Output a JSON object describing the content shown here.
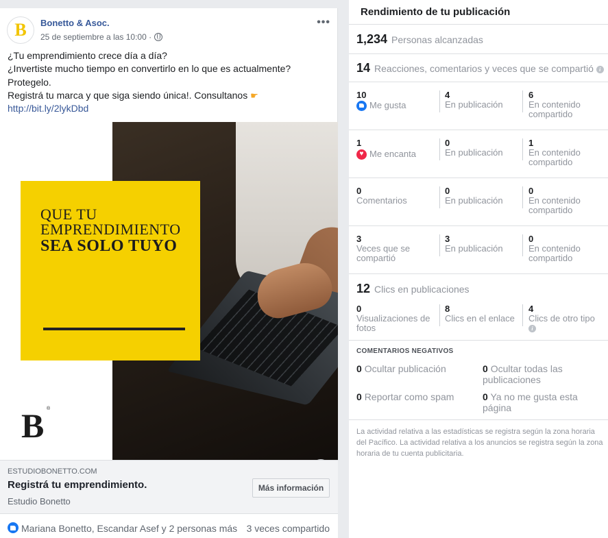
{
  "post": {
    "avatar_letter": "B",
    "author": "Bonetto & Asoc.",
    "date": "25 de septiembre a las 10:00 ·",
    "more": "•••",
    "text_lines": [
      "¿Tu emprendimiento crece día a día?",
      "¿Invertiste mucho tiempo en convertirlo en lo que es actualmente?",
      "Protegelo.",
      "Registrá tu marca y que siga siendo única!. Consultanos"
    ],
    "link": "http://bit.ly/2lykDbd",
    "ad_text": {
      "line1": "QUE TU",
      "line2": "EMPRENDIMIENTO",
      "line3": "SEA SOLO TUYO",
      "logo": "B",
      "reg": "®"
    },
    "info_glyph": "i",
    "preview": {
      "domain": "ESTUDIOBONETTO.COM",
      "title": "Registrá tu emprendimiento.",
      "description": "Estudio Bonetto",
      "cta": "Más información"
    },
    "footer": {
      "likes": "Mariana Bonetto, Escandar Asef y 2 personas más",
      "shares": "3 veces compartido"
    }
  },
  "panel": {
    "title": "Rendimiento de tu publicación",
    "reach": {
      "value": "1,234",
      "label": "Personas alcanzadas"
    },
    "engagement": {
      "value": "14",
      "label": "Reacciones, comentarios y veces que se compartió"
    },
    "rows": [
      {
        "c1_num": "10",
        "c1_label": "Me gusta",
        "c2_num": "4",
        "c2_label": "En publicación",
        "c3_num": "6",
        "c3_label": "En contenido compartido"
      },
      {
        "c1_num": "1",
        "c1_label": "Me encanta",
        "c2_num": "0",
        "c2_label": "En publicación",
        "c3_num": "1",
        "c3_label": "En contenido compartido"
      },
      {
        "c1_num": "0",
        "c1_label": "Comentarios",
        "c2_num": "0",
        "c2_label": "En publicación",
        "c3_num": "0",
        "c3_label": "En contenido compartido"
      },
      {
        "c1_num": "3",
        "c1_label": "Veces que se compartió",
        "c2_num": "3",
        "c2_label": "En publicación",
        "c3_num": "0",
        "c3_label": "En contenido compartido"
      }
    ],
    "clicks": {
      "value": "12",
      "label": "Clics en publicaciones"
    },
    "click_row": {
      "c1_num": "0",
      "c1_label": "Visualizaciones de fotos",
      "c2_num": "8",
      "c2_label": "Clics en el enlace",
      "c3_num": "4",
      "c3_label": "Clics de otro tipo"
    },
    "negative": {
      "title": "COMENTARIOS NEGATIVOS",
      "hide_post": {
        "value": "0",
        "label": "Ocultar publicación"
      },
      "hide_all": {
        "value": "0",
        "label": "Ocultar todas las publicaciones"
      },
      "spam": {
        "value": "0",
        "label": "Reportar como spam"
      },
      "unlike": {
        "value": "0",
        "label": "Ya no me gusta esta página"
      }
    },
    "footnote": "La actividad relativa a las estadísticas se registra según la zona horaria del Pacífico. La actividad relativa a los anuncios se registra según la zona horaria de tu cuenta publicitaria."
  },
  "colors": {
    "fb_blue": "#365899",
    "like_blue": "#1877f2",
    "love_red": "#f02849",
    "ad_yellow": "#f5d000"
  },
  "icons": [
    "globe-icon",
    "more-icon",
    "info-icon",
    "like-icon",
    "love-icon",
    "pointing-hand-emoji"
  ]
}
